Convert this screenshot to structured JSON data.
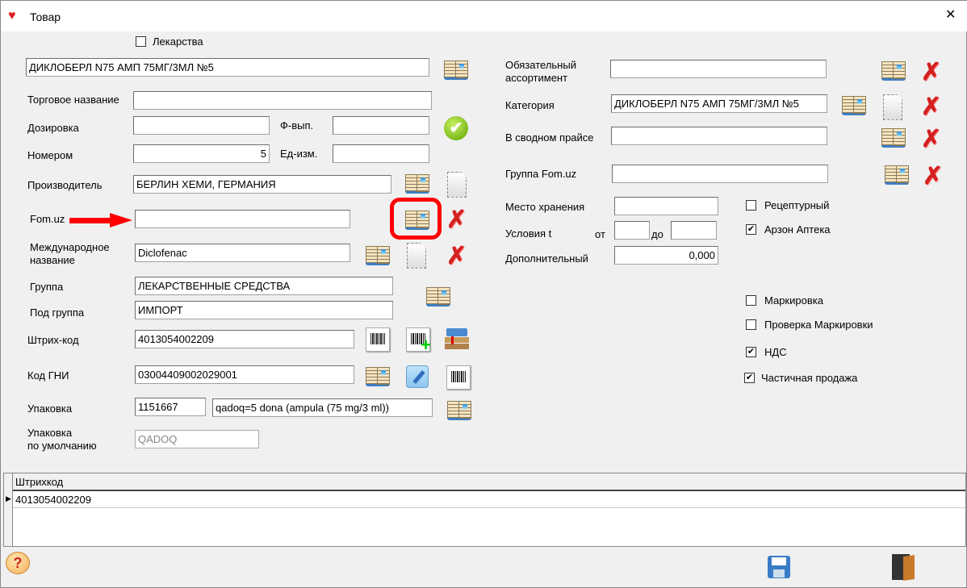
{
  "window": {
    "title": "Товар",
    "close": "✕"
  },
  "left": {
    "medicines_label": "Лекарства",
    "medicines_checked": false,
    "name_value": "ДИКЛОБЕРЛ N75 АМП 75МГ/3МЛ №5",
    "trade_name_label": "Торговое название",
    "trade_name_value": "",
    "dosage_label": "Дозировка",
    "dosage_value": "",
    "form_label": "Ф-вып.",
    "form_value": "",
    "number_label": "Номером",
    "number_value": "5",
    "unit_label": "Ед-изм.",
    "unit_value": "",
    "manufacturer_label": "Производитель",
    "manufacturer_value": "БЕРЛИН ХЕМИ, ГЕРМАНИЯ",
    "fomuz_label": "Fom.uz",
    "fomuz_value": "",
    "inn_label_1": "Международное",
    "inn_label_2": "название",
    "inn_value": "Diclofenac",
    "group_label": "Группа",
    "group_value": "ЛЕКАРСТВЕННЫЕ СРЕДСТВА",
    "subgroup_label": "Под группа",
    "subgroup_value": "ИМПОРТ",
    "barcode_label": "Штрих-код",
    "barcode_value": "4013054002209",
    "gni_label": "Код ГНИ",
    "gni_value": "03004409002029001",
    "package_label": "Упаковка",
    "package_code": "1151667",
    "package_desc": "qadoq=5 dona (ampula (75 mg/3 ml))",
    "default_package_label_1": "Упаковка",
    "default_package_label_2": "по умолчанию",
    "default_package_value": "QADOQ"
  },
  "right": {
    "mandatory_label_1": "Обязательный",
    "mandatory_label_2": "ассортимент",
    "mandatory_value": "",
    "category_label": "Категория",
    "category_value": "ДИКЛОБЕРЛ N75 АМП 75МГ/3МЛ №5",
    "pricelist_label": "В сводном прайсе",
    "pricelist_value": "",
    "fomuz_group_label": "Группа Fom.uz",
    "fomuz_group_value": "",
    "storage_label": "Место хранения",
    "storage_value": "",
    "temp_label": "Условия t",
    "temp_from_label": "от",
    "temp_from": "",
    "temp_to_label": "до",
    "temp_to": "",
    "extra_label": "Дополнительный",
    "extra_value": "0,000",
    "checkboxes": [
      {
        "label": "Рецептурный",
        "checked": false
      },
      {
        "label": "Арзон Аптека",
        "checked": true
      },
      {
        "label": "Маркировка",
        "checked": false
      },
      {
        "label": "Проверка Маркировки",
        "checked": false
      },
      {
        "label": "НДС",
        "checked": true
      },
      {
        "label": "Частичная продажа",
        "checked": true
      }
    ]
  },
  "grid": {
    "header": "Штрихкод",
    "rows": [
      "4013054002209"
    ]
  },
  "icons": {
    "check": "✔",
    "x": "✗",
    "help": "?",
    "unchecked": "",
    "checked": "✔"
  }
}
